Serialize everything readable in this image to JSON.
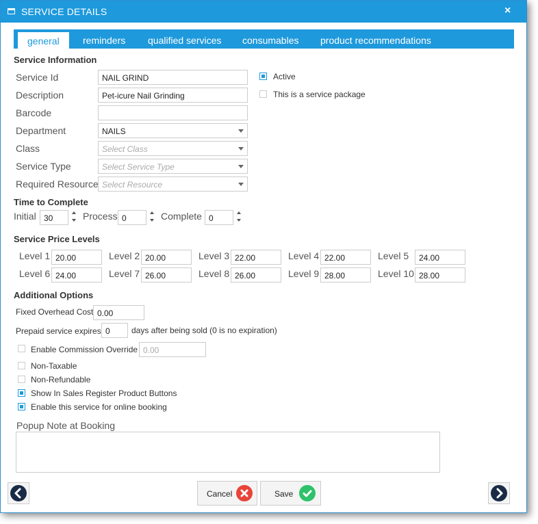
{
  "window": {
    "title": "SERVICE DETAILS",
    "close_label": "×"
  },
  "tabs": [
    {
      "label": "general"
    },
    {
      "label": "reminders"
    },
    {
      "label": "qualified services"
    },
    {
      "label": "consumables"
    },
    {
      "label": "product recommendations"
    }
  ],
  "service_information": {
    "heading": "Service Information",
    "service_id": {
      "label": "Service Id",
      "value": "NAIL GRIND"
    },
    "description": {
      "label": "Description",
      "value": "Pet-icure Nail Grinding"
    },
    "barcode": {
      "label": "Barcode",
      "value": ""
    },
    "department": {
      "label": "Department",
      "value": "NAILS"
    },
    "class": {
      "label": "Class",
      "placeholder": "Select Class"
    },
    "service_type": {
      "label": "Service Type",
      "placeholder": "Select Service Type"
    },
    "required_resource": {
      "label": "Required Resource",
      "placeholder": "Select Resource"
    },
    "active": {
      "label": "Active",
      "checked": true
    },
    "service_package": {
      "label": "This is a service package",
      "checked": false
    }
  },
  "time_to_complete": {
    "heading": "Time to Complete",
    "initial": {
      "label": "Initial",
      "value": "30"
    },
    "process": {
      "label": "Process",
      "value": "0"
    },
    "complete": {
      "label": "Complete",
      "value": "0"
    }
  },
  "price_levels": {
    "heading": "Service Price Levels",
    "levels": [
      {
        "label": "Level 1",
        "value": "20.00"
      },
      {
        "label": "Level 2",
        "value": "20.00"
      },
      {
        "label": "Level 3",
        "value": "22.00"
      },
      {
        "label": "Level 4",
        "value": "22.00"
      },
      {
        "label": "Level 5",
        "value": "24.00"
      },
      {
        "label": "Level 6",
        "value": "24.00"
      },
      {
        "label": "Level 7",
        "value": "26.00"
      },
      {
        "label": "Level 8",
        "value": "26.00"
      },
      {
        "label": "Level 9",
        "value": "28.00"
      },
      {
        "label": "Level 10",
        "value": "28.00"
      }
    ]
  },
  "additional_options": {
    "heading": "Additional Options",
    "fixed_overhead": {
      "label": "Fixed Overhead Cost",
      "value": "0.00"
    },
    "prepaid_expires": {
      "label": "Prepaid service expires",
      "value": "0",
      "suffix": "days after being sold (0 is no expiration)"
    },
    "commission_override": {
      "label": "Enable Commission Override",
      "value": "0.00",
      "checked": false
    },
    "non_taxable": {
      "label": "Non-Taxable",
      "checked": false
    },
    "non_refundable": {
      "label": "Non-Refundable",
      "checked": false
    },
    "show_in_register": {
      "label": "Show In Sales Register Product Buttons",
      "checked": true
    },
    "online_booking": {
      "label": "Enable this service for online booking",
      "checked": true
    }
  },
  "popup_note": {
    "label": "Popup Note at Booking",
    "value": ""
  },
  "footer": {
    "cancel_label": "Cancel",
    "save_label": "Save",
    "prev_icon": "chevron-left-icon",
    "next_icon": "chevron-right-icon"
  },
  "colors": {
    "accent": "#1e99dc",
    "cancel": "#e8443a",
    "save": "#2ec26a",
    "nav": "#1a2b46"
  }
}
